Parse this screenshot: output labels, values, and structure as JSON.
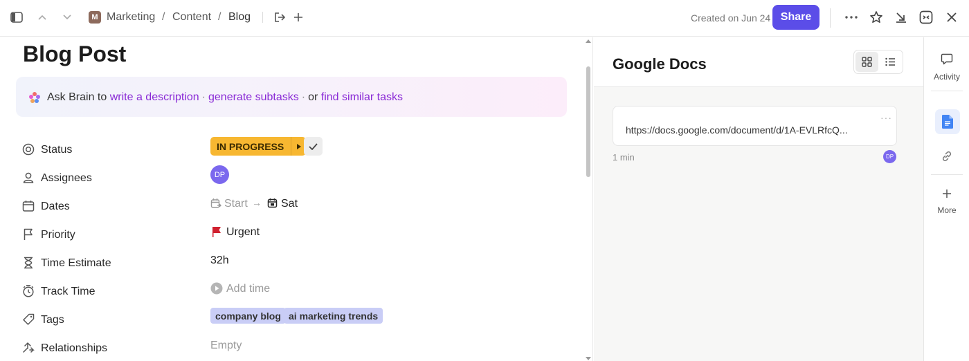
{
  "breadcrumb": {
    "space_initial": "M",
    "items": [
      "Marketing",
      "Content",
      "Blog"
    ],
    "separator": "/"
  },
  "header": {
    "created": "Created on Jun 24",
    "share_label": "Share"
  },
  "task": {
    "title": "Blog Post",
    "brain": {
      "prefix": "Ask Brain to",
      "link1": "write a description",
      "dot1": "·",
      "link2": "generate subtasks",
      "dot2": "·",
      "or": "or",
      "link3": "find similar tasks"
    },
    "fields": {
      "status": {
        "label": "Status",
        "value": "IN PROGRESS"
      },
      "assignees": {
        "label": "Assignees",
        "initials": "DP"
      },
      "dates": {
        "label": "Dates",
        "start": "Start",
        "arrow": "→",
        "due": "Sat"
      },
      "priority": {
        "label": "Priority",
        "value": "Urgent"
      },
      "time_estimate": {
        "label": "Time Estimate",
        "value": "32h"
      },
      "track_time": {
        "label": "Track Time",
        "value": "Add time"
      },
      "tags": {
        "label": "Tags",
        "items": [
          "company blog",
          "ai marketing trends"
        ]
      },
      "relationships": {
        "label": "Relationships",
        "value": "Empty"
      }
    }
  },
  "docs_panel": {
    "title": "Google Docs",
    "card": {
      "url": "https://docs.google.com/document/d/1A-EVLRfcQ...",
      "more": "···"
    },
    "time": "1 min",
    "author_initials": "DP"
  },
  "rail": {
    "activity": "Activity",
    "more": "More"
  },
  "colors": {
    "accent": "#5b4de8",
    "status": "#f7b731",
    "tag": "#c9cdf6",
    "link": "#8a2bd6",
    "urgent": "#d0202f",
    "avatar": "#7b68ee"
  }
}
